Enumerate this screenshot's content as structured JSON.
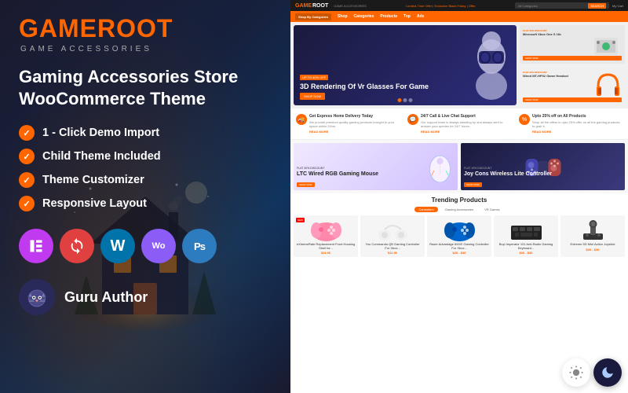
{
  "left": {
    "logo": {
      "game": "GAME",
      "root": "ROOT",
      "subtitle": "GAME ACCESSORIES"
    },
    "heading": "Gaming Accessories Store WooCommerce Theme",
    "features": [
      "1 - Click Demo Import",
      "Child Theme Included",
      "Theme Customizer",
      "Responsive Layout"
    ],
    "plugins": [
      {
        "name": "Elementor",
        "short": "E",
        "class": "pi-elementor"
      },
      {
        "name": "Customizer",
        "short": "↻",
        "class": "pi-customizer"
      },
      {
        "name": "WordPress",
        "short": "W",
        "class": "pi-wp"
      },
      {
        "name": "WooCommerce",
        "short": "Wo",
        "class": "pi-woo"
      },
      {
        "name": "Photoshop",
        "short": "Ps",
        "class": "pi-ps"
      }
    ],
    "author": {
      "icon": "🐱",
      "label": "Guru Author"
    }
  },
  "right": {
    "topbar": {
      "offer": "Limited-Time Offer | Exclusive Black Friday | Offer",
      "search_placeholder": "All Categories",
      "search_btn": "SEARCH",
      "cart": "My Cart"
    },
    "nav": {
      "items": [
        "Shop By Categories",
        "Shop",
        "Categories",
        "Products",
        "Top",
        "Ads"
      ]
    },
    "hero": {
      "discount": "UP TO 40% OFF",
      "title": "3D Rendering Of Vr Glasses For Game",
      "cta": "SHOP NOW",
      "side_products": [
        {
          "discount": "FLAT 30% DISCOUNT",
          "name": "Microsoft Xbox One S 1tb",
          "link": "SHOP NOW"
        },
        {
          "discount": "FLAT 30% DISCOUNT",
          "name": "Wired MT-HP02 Game Headset",
          "link": "SHOP NOW"
        }
      ]
    },
    "info_bar": [
      {
        "title": "Get Express Home Delivery Today",
        "desc": "We provide premium quality gaming products brought to your space within 24hrs.",
        "link": "READ MORE"
      },
      {
        "title": "24/7 Call & Live Chat Support",
        "desc": "Our support team is always standing by and always alert to answer your queries for 24/7 hours.",
        "link": "READ MORE"
      },
      {
        "title": "Upto 25% off on All Products",
        "desc": "Shop all the offers in upto 25% offer on all the gaming products to grab it.",
        "link": "READ MORE"
      }
    ],
    "products_row": [
      {
        "discount": "FLAT 30% DISCOUNT",
        "name": "LTC Wired RGB Gaming Mouse",
        "cta": "SHOP NOW",
        "style": "light"
      },
      {
        "discount": "FLAT 19% DISCOUNT",
        "name": "Joy Cons Wireless Lite Controller",
        "cta": "SHOP NOW",
        "style": "dark"
      }
    ],
    "trending": {
      "title": "Trending Products",
      "tabs": [
        "Controllers",
        "Gaming Accessories",
        "VR Games"
      ],
      "active_tab": "Controllers",
      "items": [
        {
          "name": "eXtremeRate Replacement Front Housing Shell for...",
          "price": "$11.96"
        },
        {
          "name": "You Commando QB Gaming Controller For Xbox...",
          "price": "$11.96"
        },
        {
          "name": "Razer Advantage 60GE Gaming Controller For Xbox...",
          "price": "$26 - $36"
        },
        {
          "name": "Boyi Imperator 101 Anti-Radio Gaming Keyboard...",
          "price": "$26 - $36"
        },
        {
          "name": "Extreme 5D Mini Action Joystick",
          "price": "$26 - $36"
        }
      ]
    }
  }
}
